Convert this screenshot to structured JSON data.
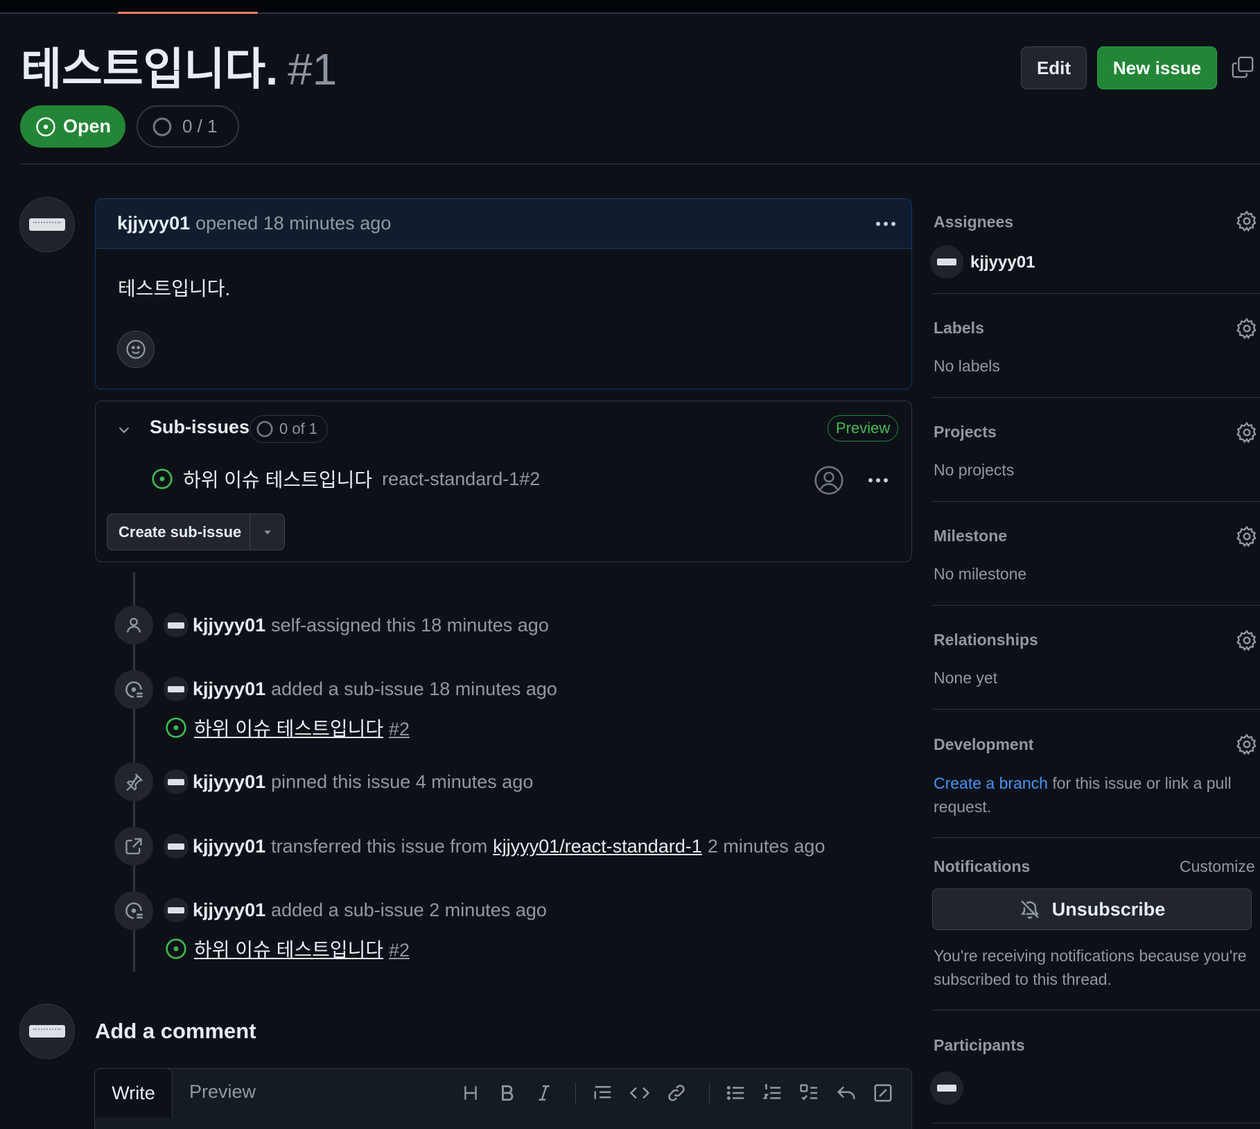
{
  "issue": {
    "title": "테스트입니다.",
    "number": "#1",
    "state": "Open",
    "progress": "0 / 1",
    "edit_label": "Edit",
    "new_issue_label": "New issue"
  },
  "comment": {
    "author": "kjjyyy01",
    "meta": "opened 18 minutes ago",
    "body": "테스트입니다."
  },
  "sub_issues": {
    "title": "Sub-issues",
    "count": "0 of 1",
    "badge": "Preview",
    "items": [
      {
        "title": "하위 이슈 테스트입니다",
        "ref": "react-standard-1#2"
      }
    ],
    "create_label": "Create sub-issue"
  },
  "timeline": [
    {
      "user": "kjjyyy01",
      "text": "self-assigned this 18 minutes ago",
      "icon": "person-icon"
    },
    {
      "user": "kjjyyy01",
      "text": "added a sub-issue 18 minutes ago",
      "icon": "sub-issue-icon",
      "sub_title": "하위 이슈 테스트입니다",
      "sub_num": "#2"
    },
    {
      "user": "kjjyyy01",
      "text": "pinned this issue 4 minutes ago",
      "icon": "pin-icon"
    },
    {
      "user": "kjjyyy01",
      "text_before": "transferred this issue from",
      "link": "kjjyyy01/react-standard-1",
      "text_after": "2 minutes ago",
      "icon": "transfer-icon"
    },
    {
      "user": "kjjyyy01",
      "text": "added a sub-issue 2 minutes ago",
      "icon": "sub-issue-icon",
      "sub_title": "하위 이슈 테스트입니다",
      "sub_num": "#2"
    }
  ],
  "add_comment": {
    "title": "Add a comment",
    "tab_write": "Write",
    "tab_preview": "Preview"
  },
  "sidebar": {
    "assignees": {
      "label": "Assignees",
      "value": "kjjyyy01"
    },
    "labels": {
      "label": "Labels",
      "value": "No labels"
    },
    "projects": {
      "label": "Projects",
      "value": "No projects"
    },
    "milestone": {
      "label": "Milestone",
      "value": "No milestone"
    },
    "relationships": {
      "label": "Relationships",
      "value": "None yet"
    },
    "development": {
      "label": "Development",
      "link": "Create a branch",
      "rest_line1": "for this issue or link a pull",
      "rest_line2": "request."
    },
    "notifications": {
      "label": "Notifications",
      "customize": "Customize",
      "button": "Unsubscribe",
      "info_line1": "You're receiving notifications because you're",
      "info_line2": "subscribed to this thread."
    },
    "participants": {
      "label": "Participants"
    }
  },
  "colors": {
    "green": "#238636",
    "blue_link": "#4493f8",
    "open_icon": "#3fb950",
    "accent_underline": "#f78166"
  }
}
